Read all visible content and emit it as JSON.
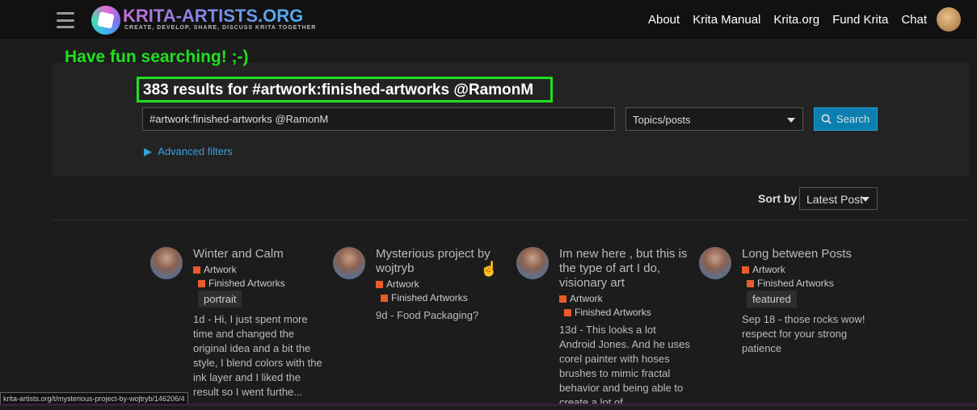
{
  "header": {
    "logo_text": "KRITA-ARTISTS.ORG",
    "logo_tagline": "CREATE, DEVELOP, SHARE, DISCUSS KRITA TOGETHER",
    "nav": [
      "About",
      "Krita Manual",
      "Krita.org",
      "Fund Krita",
      "Chat"
    ]
  },
  "annotation": "Have fun searching! ;-)",
  "search": {
    "results_title": "383 results for #artwork:finished-artworks @RamonM",
    "query": "#artwork:finished-artworks @RamonM",
    "scope": "Topics/posts",
    "button": "Search",
    "advanced": "Advanced filters"
  },
  "sort": {
    "label": "Sort by",
    "value": "Latest Post"
  },
  "results": [
    {
      "title": "Winter and Calm",
      "category": "Artwork",
      "subcategory": "Finished Artworks",
      "tag": "portrait",
      "excerpt": "1d - Hi, I just spent more time and changed the original idea and a bit the style, I blend colors with the ink layer and I liked the result so I went furthe..."
    },
    {
      "title": "Mysterious project by wojtryb",
      "category": "Artwork",
      "subcategory": "Finished Artworks",
      "excerpt": "9d - Food Packaging?"
    },
    {
      "title": "Im new here , but this is the type of art I do, visionary art",
      "category": "Artwork",
      "subcategory": "Finished Artworks",
      "excerpt": "13d - This looks a lot Android Jones. And he uses corel painter with hoses brushes to mimic fractal behavior and being able to create a lot of"
    },
    {
      "title": "Long between Posts",
      "category": "Artwork",
      "subcategory": "Finished Artworks",
      "tag": "featured",
      "excerpt": "Sep 18 - those rocks wow! respect for your strong patience"
    }
  ],
  "status_url": "krita-artists.org/t/mysterious-project-by-wojtryb/146206/4",
  "colors": {
    "annotation": "#1fe01f",
    "accent": "#0a7fb0",
    "category": "#e85b2a"
  }
}
